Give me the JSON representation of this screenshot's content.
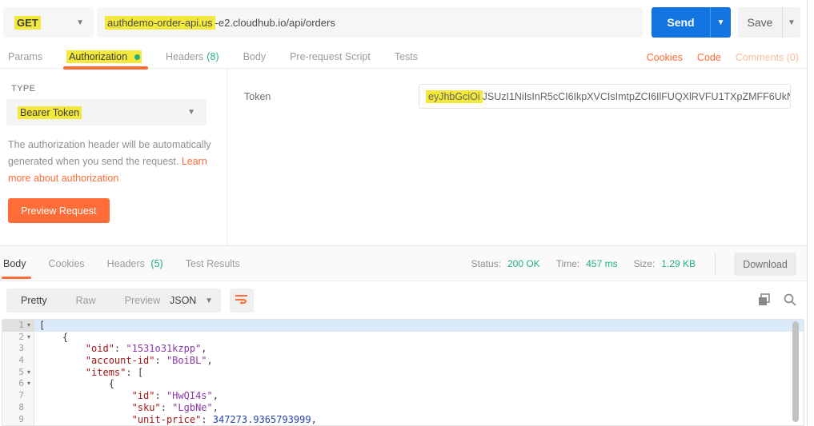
{
  "colors": {
    "orange": "#FF6C37",
    "green": "#23B179",
    "send_blue": "#1375E1",
    "highlight_yellow": "#F3E93C",
    "json_key": "#A31515",
    "json_string": "#8937A8",
    "json_number": "#2443AE"
  },
  "request_bar": {
    "method": "GET",
    "url_highlighted": "authdemo-order-api.us",
    "url_rest": "-e2.cloudhub.io/api/orders",
    "send": "Send",
    "save": "Save"
  },
  "request_tabs": {
    "params": "Params",
    "authorization": "Authorization",
    "headers_label": "Headers",
    "headers_count": "(8)",
    "body": "Body",
    "prerequest": "Pre-request Script",
    "tests": "Tests"
  },
  "header_links": {
    "cookies": "Cookies",
    "code": "Code",
    "comments": "Comments (0)"
  },
  "auth": {
    "type_label": "TYPE",
    "type_value": "Bearer Token",
    "help_text": "The authorization header will be automatically generated when you send the request. ",
    "help_link": "Learn more about authorization",
    "preview_button": "Preview Request",
    "token_label": "Token",
    "token_highlighted": "eyJhbGciOi",
    "token_rest": "JSUzI1NiIsInR5cCI6IkpXVCIsImtpZCI6IlFUQXlRVFU1TXpZMFF6UkN..."
  },
  "response": {
    "tabs": {
      "body": "Body",
      "cookies": "Cookies",
      "headers_label": "Headers",
      "headers_count": "(5)",
      "test_results": "Test Results"
    },
    "status_label": "Status:",
    "status_value": "200 OK",
    "time_label": "Time:",
    "time_value": "457 ms",
    "size_label": "Size:",
    "size_value": "1.29 KB",
    "download": "Download",
    "view_modes": {
      "pretty": "Pretty",
      "raw": "Raw",
      "preview": "Preview"
    },
    "language": "JSON"
  },
  "response_body": {
    "lines": [
      {
        "num": "1",
        "fold": true,
        "selected": true,
        "segments": [
          {
            "t": "[",
            "c": "p"
          }
        ]
      },
      {
        "num": "2",
        "fold": true,
        "selected": false,
        "segments": [
          {
            "t": "    {",
            "c": "p"
          }
        ]
      },
      {
        "num": "3",
        "fold": false,
        "selected": false,
        "segments": [
          {
            "t": "        ",
            "c": "p"
          },
          {
            "t": "\"oid\"",
            "c": "k"
          },
          {
            "t": ": ",
            "c": "p"
          },
          {
            "t": "\"1531o31kzpp\"",
            "c": "s"
          },
          {
            "t": ",",
            "c": "p"
          }
        ]
      },
      {
        "num": "4",
        "fold": false,
        "selected": false,
        "segments": [
          {
            "t": "        ",
            "c": "p"
          },
          {
            "t": "\"account-id\"",
            "c": "k"
          },
          {
            "t": ": ",
            "c": "p"
          },
          {
            "t": "\"BoiBL\"",
            "c": "s"
          },
          {
            "t": ",",
            "c": "p"
          }
        ]
      },
      {
        "num": "5",
        "fold": true,
        "selected": false,
        "segments": [
          {
            "t": "        ",
            "c": "p"
          },
          {
            "t": "\"items\"",
            "c": "k"
          },
          {
            "t": ": [",
            "c": "p"
          }
        ]
      },
      {
        "num": "6",
        "fold": true,
        "selected": false,
        "segments": [
          {
            "t": "            {",
            "c": "p"
          }
        ]
      },
      {
        "num": "7",
        "fold": false,
        "selected": false,
        "segments": [
          {
            "t": "                ",
            "c": "p"
          },
          {
            "t": "\"id\"",
            "c": "k"
          },
          {
            "t": ": ",
            "c": "p"
          },
          {
            "t": "\"HwQI4s\"",
            "c": "s"
          },
          {
            "t": ",",
            "c": "p"
          }
        ]
      },
      {
        "num": "8",
        "fold": false,
        "selected": false,
        "segments": [
          {
            "t": "                ",
            "c": "p"
          },
          {
            "t": "\"sku\"",
            "c": "k"
          },
          {
            "t": ": ",
            "c": "p"
          },
          {
            "t": "\"LgbNe\"",
            "c": "s"
          },
          {
            "t": ",",
            "c": "p"
          }
        ]
      },
      {
        "num": "9",
        "fold": false,
        "selected": false,
        "segments": [
          {
            "t": "                ",
            "c": "p"
          },
          {
            "t": "\"unit-price\"",
            "c": "k"
          },
          {
            "t": ": ",
            "c": "p"
          },
          {
            "t": "347273.9365793999",
            "c": "n"
          },
          {
            "t": ",",
            "c": "p"
          }
        ]
      }
    ]
  }
}
